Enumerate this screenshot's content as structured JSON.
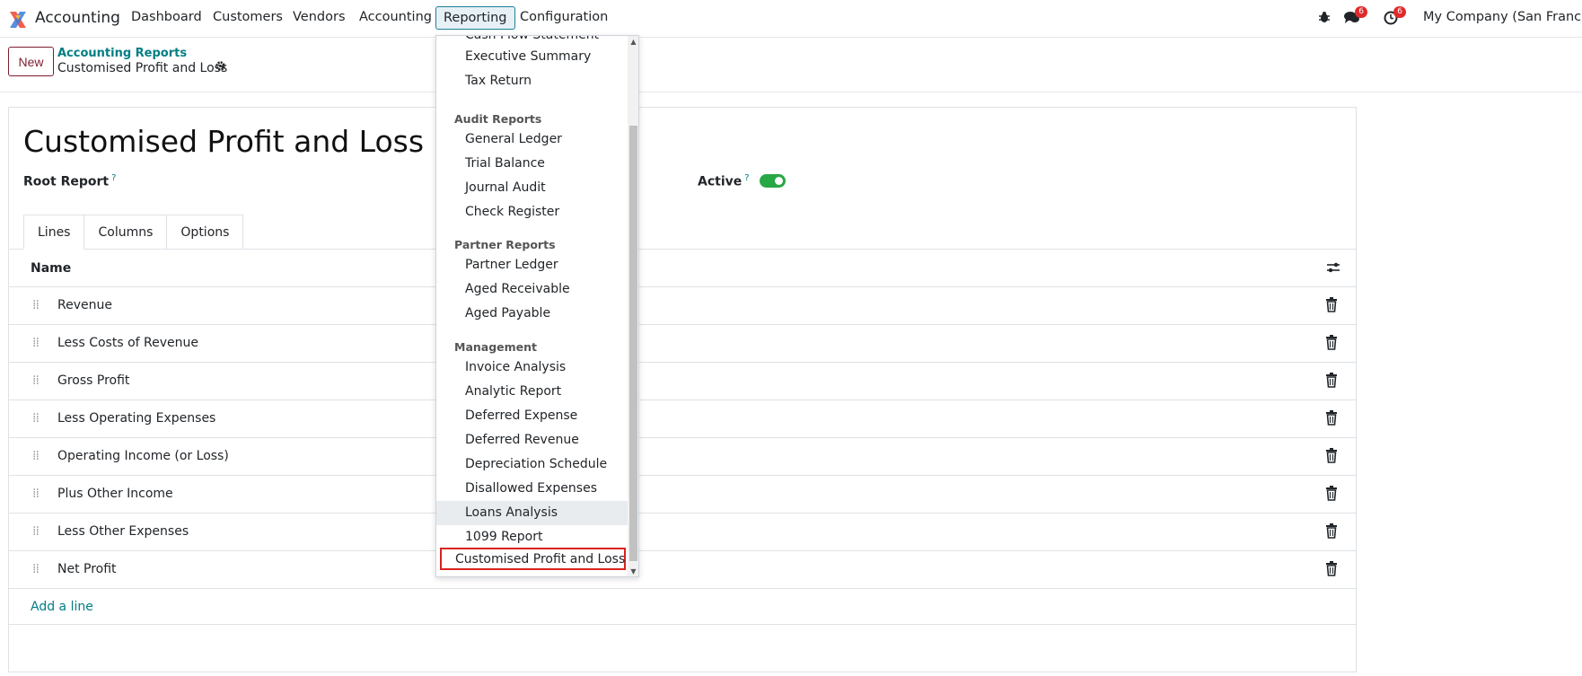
{
  "navbar": {
    "app_name": "Accounting",
    "menu": [
      "Dashboard",
      "Customers",
      "Vendors",
      "Accounting",
      "Reporting",
      "Configuration"
    ],
    "messages_count": "6",
    "activities_count": "6",
    "company": "My Company (San Francisco)"
  },
  "control_panel": {
    "new_label": "New",
    "breadcrumb_parent": "Accounting Reports",
    "breadcrumb_current": "Customised Profit and Loss"
  },
  "form": {
    "title": "Customised Profit and Loss",
    "root_report_label": "Root Report",
    "active_label": "Active",
    "help_mark": "?",
    "active": true,
    "tabs": [
      "Lines",
      "Columns",
      "Options"
    ],
    "column_name": "Name",
    "lines": [
      "Revenue",
      "Less Costs of Revenue",
      "Gross Profit",
      "Less Operating Expenses",
      "Operating Income (or Loss)",
      "Plus Other Income",
      "Less Other Expenses",
      "Net Profit"
    ],
    "add_line": "Add a line"
  },
  "dropdown": {
    "partial_top": "Cash Flow Statement",
    "top_items": [
      "Executive Summary",
      "Tax Return"
    ],
    "sections": [
      {
        "title": "Audit Reports",
        "items": [
          "General Ledger",
          "Trial Balance",
          "Journal Audit",
          "Check Register"
        ]
      },
      {
        "title": "Partner Reports",
        "items": [
          "Partner Ledger",
          "Aged Receivable",
          "Aged Payable"
        ]
      },
      {
        "title": "Management",
        "items": [
          "Invoice Analysis",
          "Analytic Report",
          "Deferred Expense",
          "Deferred Revenue",
          "Depreciation Schedule",
          "Disallowed Expenses",
          "Loans Analysis",
          "1099 Report"
        ]
      }
    ],
    "highlighted_item": "Customised Profit and Loss",
    "hovered_item": "Loans Analysis"
  },
  "colors": {
    "brand": "#7d1c2e",
    "link": "#017e84",
    "toggle_on": "#28a745",
    "badge": "#e02a2a",
    "highlight_border": "#d9231f"
  }
}
